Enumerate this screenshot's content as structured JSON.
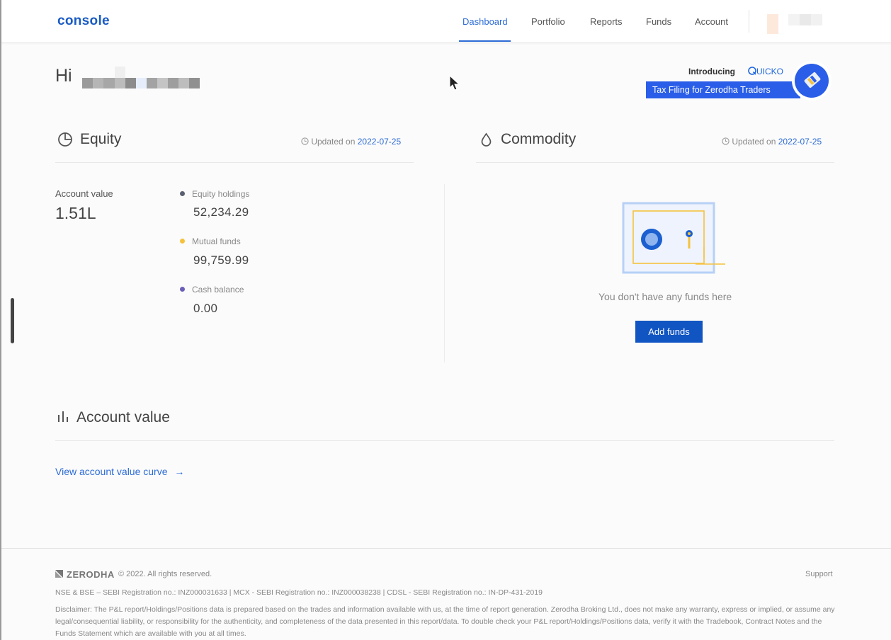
{
  "header": {
    "logo": "console",
    "nav": [
      {
        "label": "Dashboard",
        "active": true
      },
      {
        "label": "Portfolio",
        "active": false
      },
      {
        "label": "Reports",
        "active": false
      },
      {
        "label": "Funds",
        "active": false
      },
      {
        "label": "Account",
        "active": false
      }
    ]
  },
  "greeting": {
    "hi": "Hi"
  },
  "banner": {
    "introducing": "Introducing",
    "brand": "UICKO",
    "tagline": "Tax Filing for Zerodha Traders"
  },
  "equity": {
    "title": "Equity",
    "updated_prefix": "Updated on",
    "updated_date": "2022-07-25",
    "account_value_label": "Account value",
    "account_value": "1.51L",
    "breakdown": [
      {
        "label": "Equity holdings",
        "value": "52,234.29",
        "color": "#5a6072"
      },
      {
        "label": "Mutual funds",
        "value": "99,759.99",
        "color": "#f5c23e"
      },
      {
        "label": "Cash balance",
        "value": "0.00",
        "color": "#6a5fb8"
      }
    ]
  },
  "commodity": {
    "title": "Commodity",
    "updated_prefix": "Updated on",
    "updated_date": "2022-07-25",
    "empty_text": "You don't have any funds here",
    "add_funds": "Add funds"
  },
  "account_value": {
    "title": "Account value",
    "link": "View account value curve",
    "link_arrow": "→"
  },
  "footer": {
    "brand": "ZERODHA",
    "copyright": "© 2022. All rights reserved.",
    "support": "Support",
    "registration": "NSE & BSE – SEBI Registration no.: INZ000031633 | MCX - SEBI Registration no.: INZ000038238 | CDSL - SEBI Registration no.: IN-DP-431-2019",
    "disclaimer": "Disclaimer: The P&L report/Holdings/Positions data is prepared based on the trades and information available with us, at the time of report generation. Zerodha Broking Ltd., does not make any warranty, express or implied, or assume any legal/consequential liability, or responsibility for the authenticity, and completeness of the data presented in this report/data. To double check your P&L report/Holdings/Positions data, verify it with the Tradebook, Contract Notes and the Funds Statement which are available with you at all times."
  },
  "colors": {
    "accent": "#2c6bd6",
    "button": "#1155c2",
    "banner": "#2a5ee8"
  }
}
